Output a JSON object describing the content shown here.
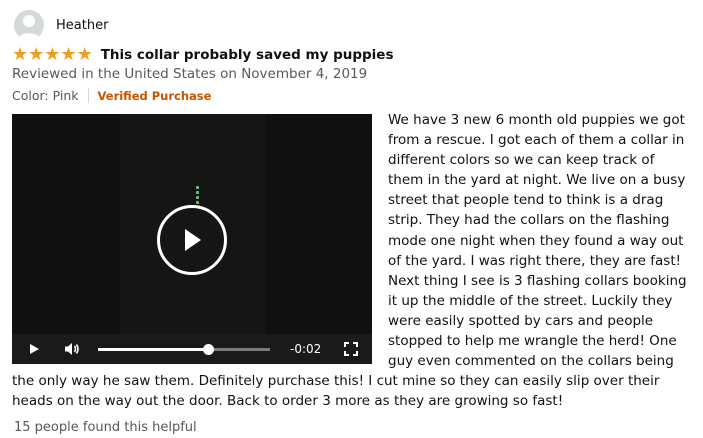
{
  "reviewer": {
    "name": "Heather",
    "avatar_icon": "user-silhouette-icon"
  },
  "review": {
    "rating": 5,
    "rating_max": 5,
    "title": "This collar probably saved my puppies",
    "date": "Reviewed in the United States on November 4, 2019",
    "color": "Color: Pink",
    "verified": "Verified Purchase",
    "body": " We have 3 new 6 month old puppies we got from a rescue. I got each of them a collar in different colors so we can keep track of them in the yard at night. We live on a busy street that people tend to think is a drag strip. They had the collars on the flashing mode one night when they found a way out of the yard. I was right there, they are fast! Next thing I see is 3 flashing collars booking it up the middle of the street. Luckily they were easily spotted by cars and people stopped to help me wrangle the herd! One guy even commented on the collars being the only way he saw them. Definitely purchase this! I cut mine so they can easily slip over their heads on the way out the door. Back to order 3 more as they are growing so fast!",
    "helpful": "15 people found this helpful"
  },
  "video": {
    "time_remaining": "-0:02",
    "progress": 0.64,
    "icons": [
      "play-icon",
      "volume-icon",
      "fullscreen-icon",
      "play-overlay-icon"
    ]
  },
  "colors": {
    "star": "#f29d1f",
    "verified": "#c45500",
    "muted": "#565959"
  }
}
